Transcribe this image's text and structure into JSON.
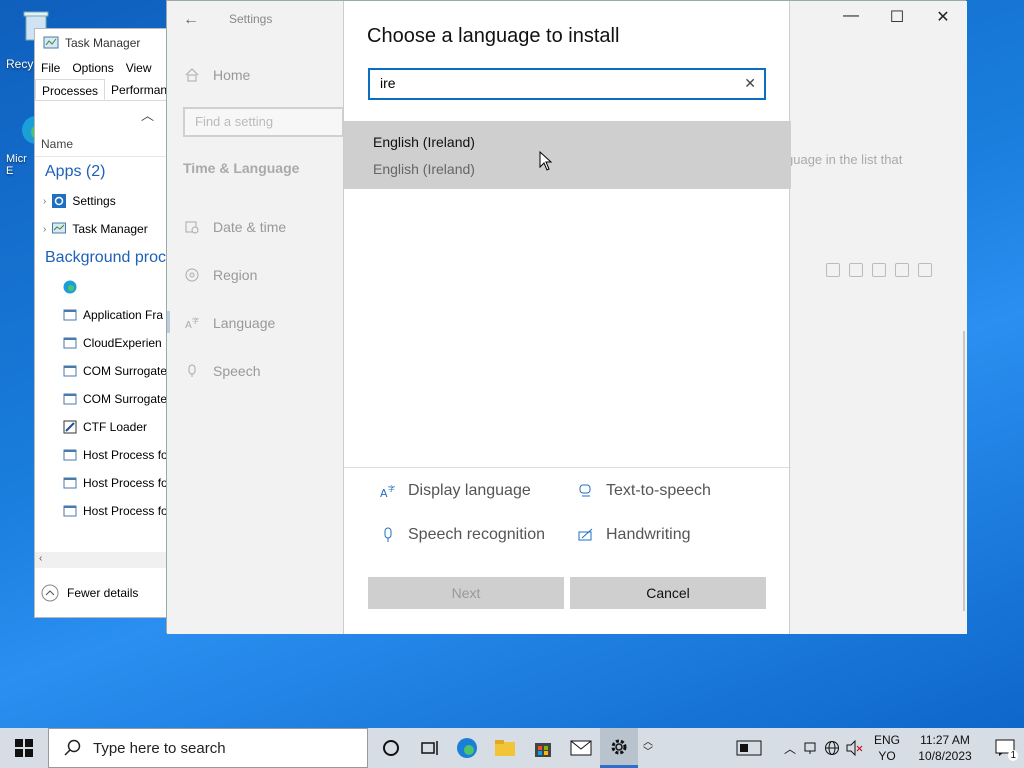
{
  "desktop": {
    "icons": [
      {
        "label": "Recy"
      },
      {
        "label": "Micr\nE"
      }
    ]
  },
  "task_manager": {
    "title": "Task Manager",
    "menu": [
      "File",
      "Options",
      "View"
    ],
    "tabs": [
      "Processes",
      "Performanc"
    ],
    "column": "Name",
    "apps_group": "Apps (2)",
    "apps": [
      "Settings",
      "Task Manager"
    ],
    "bg_group": "Background proce",
    "bg": [
      "",
      "Application Fra",
      "CloudExperien",
      "COM Surrogate",
      "COM Surrogate",
      "CTF Loader",
      "Host Process fo",
      "Host Process fo",
      "Host Process fo"
    ],
    "fewer": "Fewer details"
  },
  "settings": {
    "title": "Settings",
    "home": "Home",
    "find_placeholder": "Find a setting",
    "section": "Time & Language",
    "nav": [
      "Date & time",
      "Region",
      "Language",
      "Speech"
    ],
    "right_text": "guage in the list that"
  },
  "dialog": {
    "heading": "Choose a language to install",
    "search_value": "ire",
    "result_name": "English (Ireland)",
    "result_native": "English (Ireland)",
    "features": [
      "Display language",
      "Text-to-speech",
      "Speech recognition",
      "Handwriting"
    ],
    "next": "Next",
    "cancel": "Cancel"
  },
  "taskbar": {
    "search": "Type here to search",
    "lang1": "ENG",
    "lang2": "YO",
    "time": "11:27 AM",
    "date": "10/8/2023",
    "notif_count": "1"
  },
  "colors": {
    "accent": "#0a6fc2",
    "selected_row": "#cfcfcf",
    "tm_group": "#1e60b9"
  }
}
